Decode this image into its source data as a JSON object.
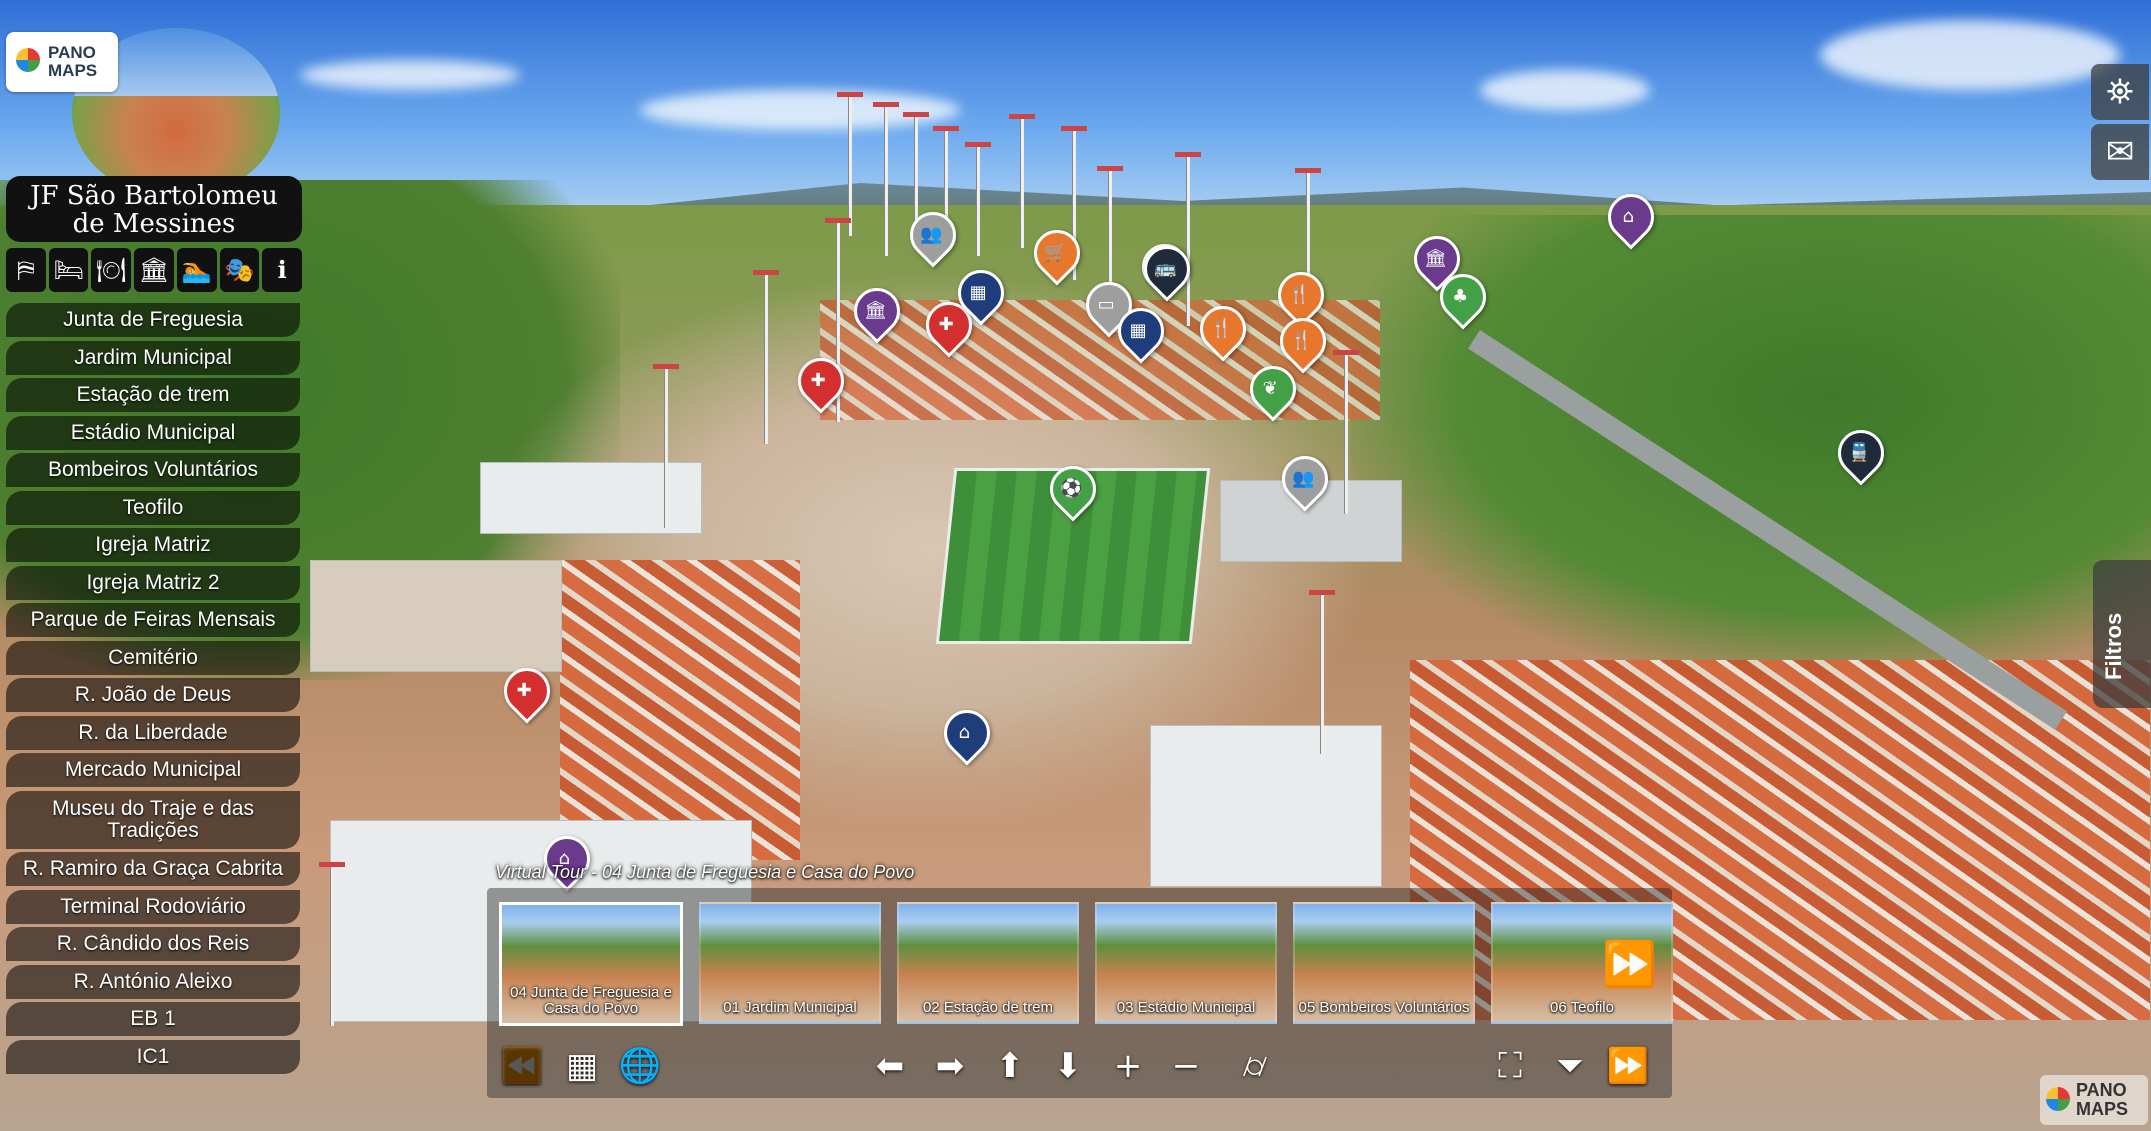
{
  "logo": {
    "line1": "PANO",
    "line2": "MAPS"
  },
  "title": {
    "line1": "JF São Bartolomeu",
    "line2": "de Messines"
  },
  "category_icons": [
    {
      "name": "signpost-icon",
      "glyph": "⛿"
    },
    {
      "name": "bed-icon",
      "glyph": "🛏"
    },
    {
      "name": "restaurant-icon",
      "glyph": "🍽"
    },
    {
      "name": "museum-icon",
      "glyph": "🏛"
    },
    {
      "name": "swimming-icon",
      "glyph": "🏊"
    },
    {
      "name": "theater-icon",
      "glyph": "🎭"
    },
    {
      "name": "info-icon",
      "glyph": "ℹ"
    }
  ],
  "menu": [
    "Junta de Freguesia",
    "Jardim Municipal",
    "Estação de trem",
    "Estádio Municipal",
    "Bombeiros Voluntários",
    "Teofilo",
    "Igreja Matriz",
    "Igreja Matriz 2",
    "Parque de Feiras Mensais",
    "Cemitério",
    "R. João de Deus",
    "R. da Liberdade",
    "Mercado Municipal",
    "Museu do Traje e das Tradições",
    "R. Ramiro da Graça Cabrita",
    "Terminal Rodoviário",
    "R. Cândido dos Reis",
    "R. António Aleixo",
    "EB 1",
    "IC1"
  ],
  "right_panel": {
    "filters_label": "Filtros",
    "map_icon": "map-icon",
    "mail_icon": "mail-icon"
  },
  "tour": {
    "title": "Virtual Tour - 04 Junta de Freguesia e Casa do Povo",
    "thumbnails": [
      "04 Junta de Freguesia e Casa do Povo",
      "01 Jardim Municipal",
      "02 Estação de trem",
      "03 Estádio Municipal",
      "05 Bombeiros Voluntários",
      "06 Teofilo"
    ]
  },
  "watermark": {
    "line1": "PANO",
    "line2": "MAPS"
  },
  "colors": {
    "pin_red": "#d32f2f",
    "pin_purple": "#6a3a8c",
    "pin_orange": "#e8772e",
    "pin_green": "#43a047",
    "pin_grey": "#9e9e9e",
    "pin_navy": "#1f3d7a",
    "panel_bg": "#111111"
  }
}
